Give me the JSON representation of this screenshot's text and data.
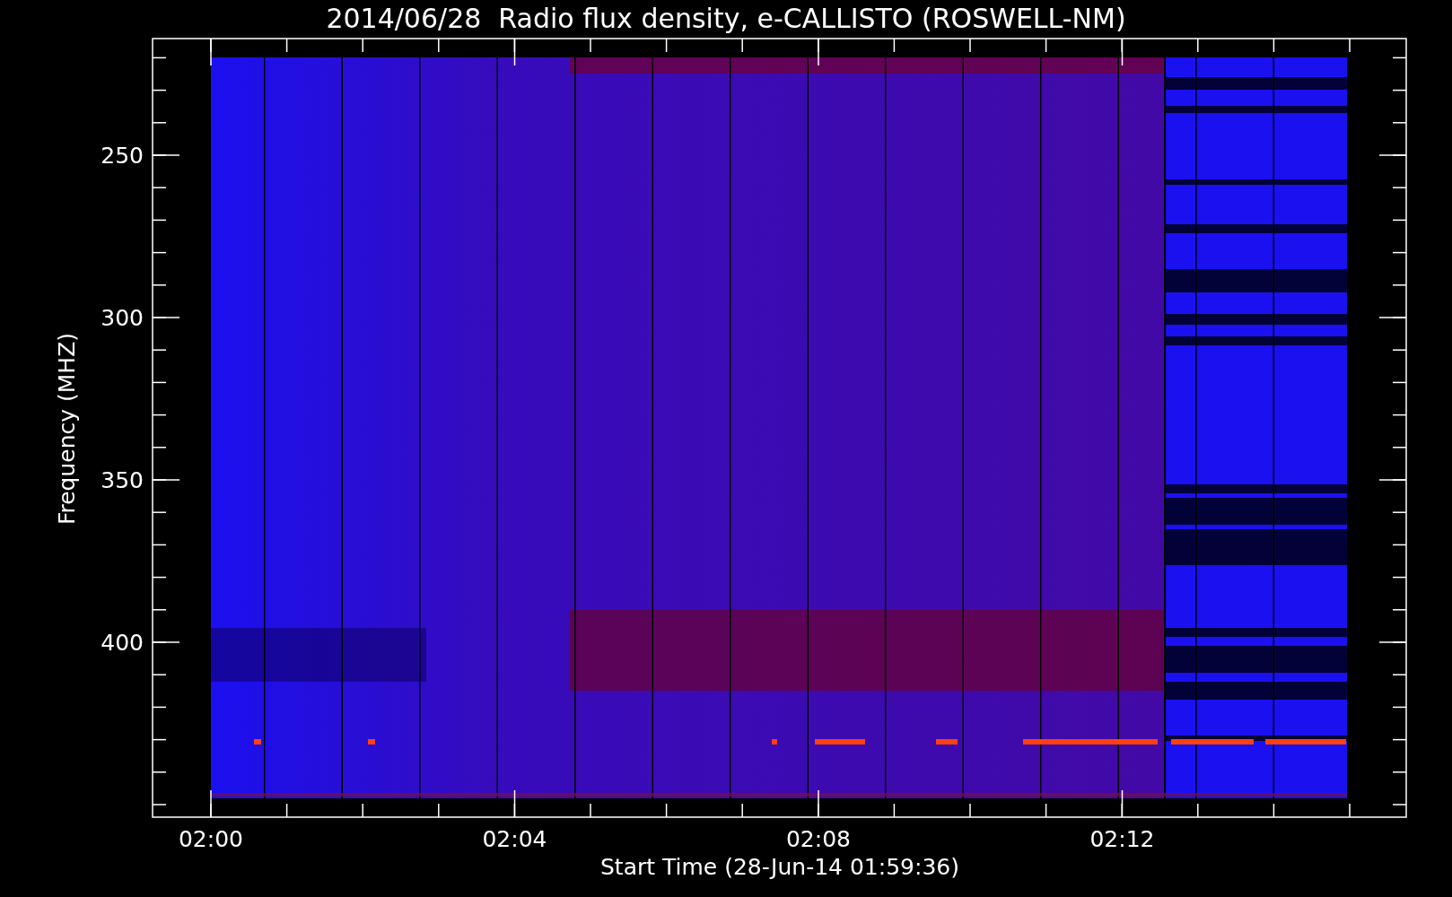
{
  "title": "2014/06/28  Radio flux density, e-CALLISTO (ROSWELL-NM)",
  "y_axis": {
    "label": "Frequency (MHZ)",
    "ticks": [
      "250",
      "300",
      "350",
      "400"
    ]
  },
  "x_axis": {
    "label": "Start Time (28-Jun-14 01:59:36)",
    "ticks": [
      "02:00",
      "02:04",
      "02:08",
      "02:12"
    ]
  }
}
